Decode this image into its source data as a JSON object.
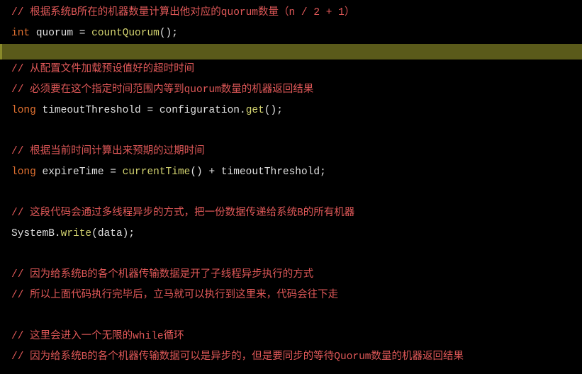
{
  "lines": {
    "c1": "// 根据系统B所在的机器数量计算出他对应的quorum数量（n / 2 + 1）",
    "l2_kw": "int",
    "l2_sp1": " ",
    "l2_id": "quorum",
    "l2_sp2": " ",
    "l2_eq": "=",
    "l2_sp3": " ",
    "l2_fn": "countQuorum",
    "l2_paren": "();",
    "c4": "// 从配置文件加载预设值好的超时时间",
    "c5": "// 必须要在这个指定时间范围内等到quorum数量的机器返回结果",
    "l6_kw": "long",
    "l6_sp1": " ",
    "l6_id": "timeoutThreshold",
    "l6_sp2": " ",
    "l6_eq": "=",
    "l6_sp3": " ",
    "l6_obj": "configuration",
    "l6_dot": ".",
    "l6_fn": "get",
    "l6_paren": "();",
    "c8": "// 根据当前时间计算出来预期的过期时间",
    "l9_kw": "long",
    "l9_sp1": " ",
    "l9_id": "expireTime",
    "l9_sp2": " ",
    "l9_eq": "=",
    "l9_sp3": " ",
    "l9_fn1": "currentTime",
    "l9_paren1": "()",
    "l9_sp4": " ",
    "l9_plus": "+",
    "l9_sp5": " ",
    "l9_id2": "timeoutThreshold",
    "l9_semi": ";",
    "c11": "// 这段代码会通过多线程异步的方式，把一份数据传递给系统B的所有机器",
    "l12_obj": "SystemB",
    "l12_dot": ".",
    "l12_fn": "write",
    "l12_open": "(",
    "l12_arg": "data",
    "l12_close": ");",
    "c14": "// 因为给系统B的各个机器传输数据是开了子线程异步执行的方式",
    "c15": "// 所以上面代码执行完毕后，立马就可以执行到这里来，代码会往下走",
    "c17": "// 这里会进入一个无限的while循环",
    "c18": "// 因为给系统B的各个机器传输数据可以是异步的，但是要同步的等待Quorum数量的机器返回结果"
  }
}
